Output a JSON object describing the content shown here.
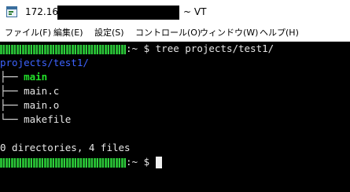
{
  "window": {
    "title_ip": "172.16.",
    "title_suffix": "~ VT"
  },
  "menu": [
    "ファイル(F)",
    "編集(E)",
    "設定(S)",
    "コントロール(O)",
    "ウィンドウ(W)",
    "ヘルプ(H)"
  ],
  "terminal": {
    "prompt_suffix": ":~ $",
    "command": "tree projects/test1/",
    "tree_root": "projects/test1/",
    "entries": [
      {
        "branch": "├──",
        "name": "main"
      },
      {
        "branch": "├──",
        "name": "main.c"
      },
      {
        "branch": "├──",
        "name": "main.o"
      },
      {
        "branch": "└──",
        "name": "makefile"
      }
    ],
    "summary": "0 directories, 4 files",
    "prompt2_suffix": ":~ $"
  },
  "colors": {
    "prompt_green": "#22e02a",
    "directory_blue": "#3d63ff",
    "executable_green": "#22e02a",
    "text": "#e6e6e6",
    "background": "#000000"
  }
}
